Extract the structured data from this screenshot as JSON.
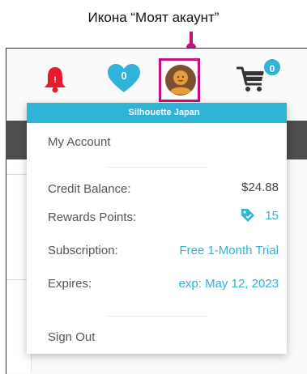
{
  "annotation": {
    "title": "Икона “Моят акаунт”",
    "highlight_color": "#c2127f"
  },
  "header": {
    "notifications_icon": "bell-icon",
    "wishlist_icon": "heart-icon",
    "wishlist_count": "0",
    "account_icon": "avatar-icon",
    "cart_icon": "cart-icon",
    "cart_count": "0"
  },
  "dropdown": {
    "brand": "Silhouette Japan",
    "my_account": "My Account",
    "credit_label": "Credit Balance:",
    "credit_value": "$24.88",
    "rewards_label": "Rewards Points:",
    "rewards_value": "15",
    "rewards_icon": "tag-icon",
    "subscription_label": "Subscription:",
    "subscription_value": "Free 1-Month Trial",
    "expires_label": "Expires:",
    "expires_value": "exp: May 12, 2023",
    "sign_out": "Sign Out"
  },
  "colors": {
    "accent": "#2fb3d6",
    "bell": "#e8192c",
    "highlight": "#c2127f",
    "dark_strip": "#4e4e4e"
  }
}
